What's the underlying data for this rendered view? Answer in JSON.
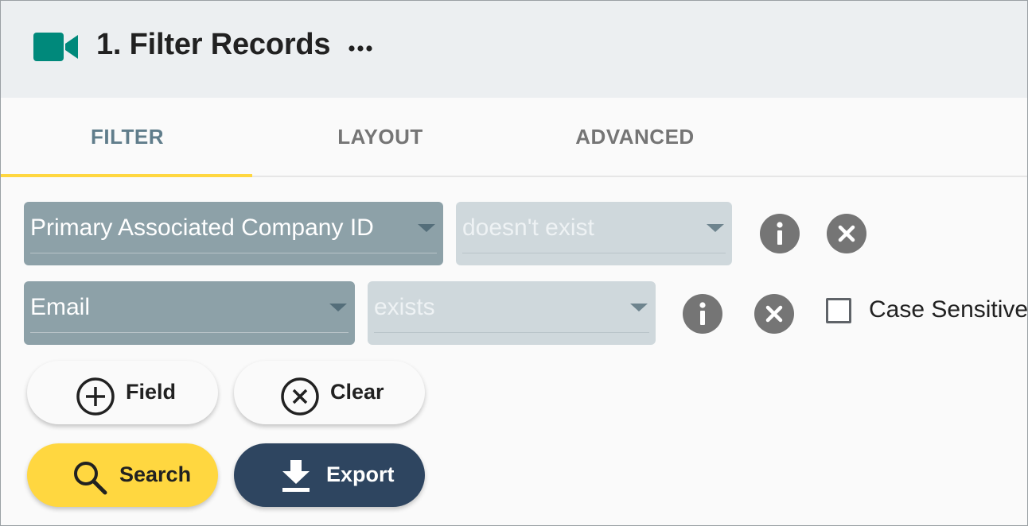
{
  "header": {
    "title": "1. Filter Records",
    "icon": "video-camera-icon",
    "menu_icon": "more-horizontal-icon",
    "accent": "#00897b"
  },
  "tabs": [
    {
      "label": "FILTER",
      "active": true
    },
    {
      "label": "LAYOUT",
      "active": false
    },
    {
      "label": "ADVANCED",
      "active": false
    }
  ],
  "filters": [
    {
      "field": "Primary Associated Company ID",
      "operator": "doesn't exist"
    },
    {
      "field": "Email",
      "operator": "exists",
      "case_sensitive_label": "Case Sensitive",
      "case_sensitive": false
    }
  ],
  "buttons": {
    "field": "Field",
    "clear": "Clear",
    "search": "Search",
    "export": "Export"
  },
  "colors": {
    "tab_indicator": "#ffd740",
    "search_button": "#ffd740",
    "export_button": "#2e4560"
  }
}
